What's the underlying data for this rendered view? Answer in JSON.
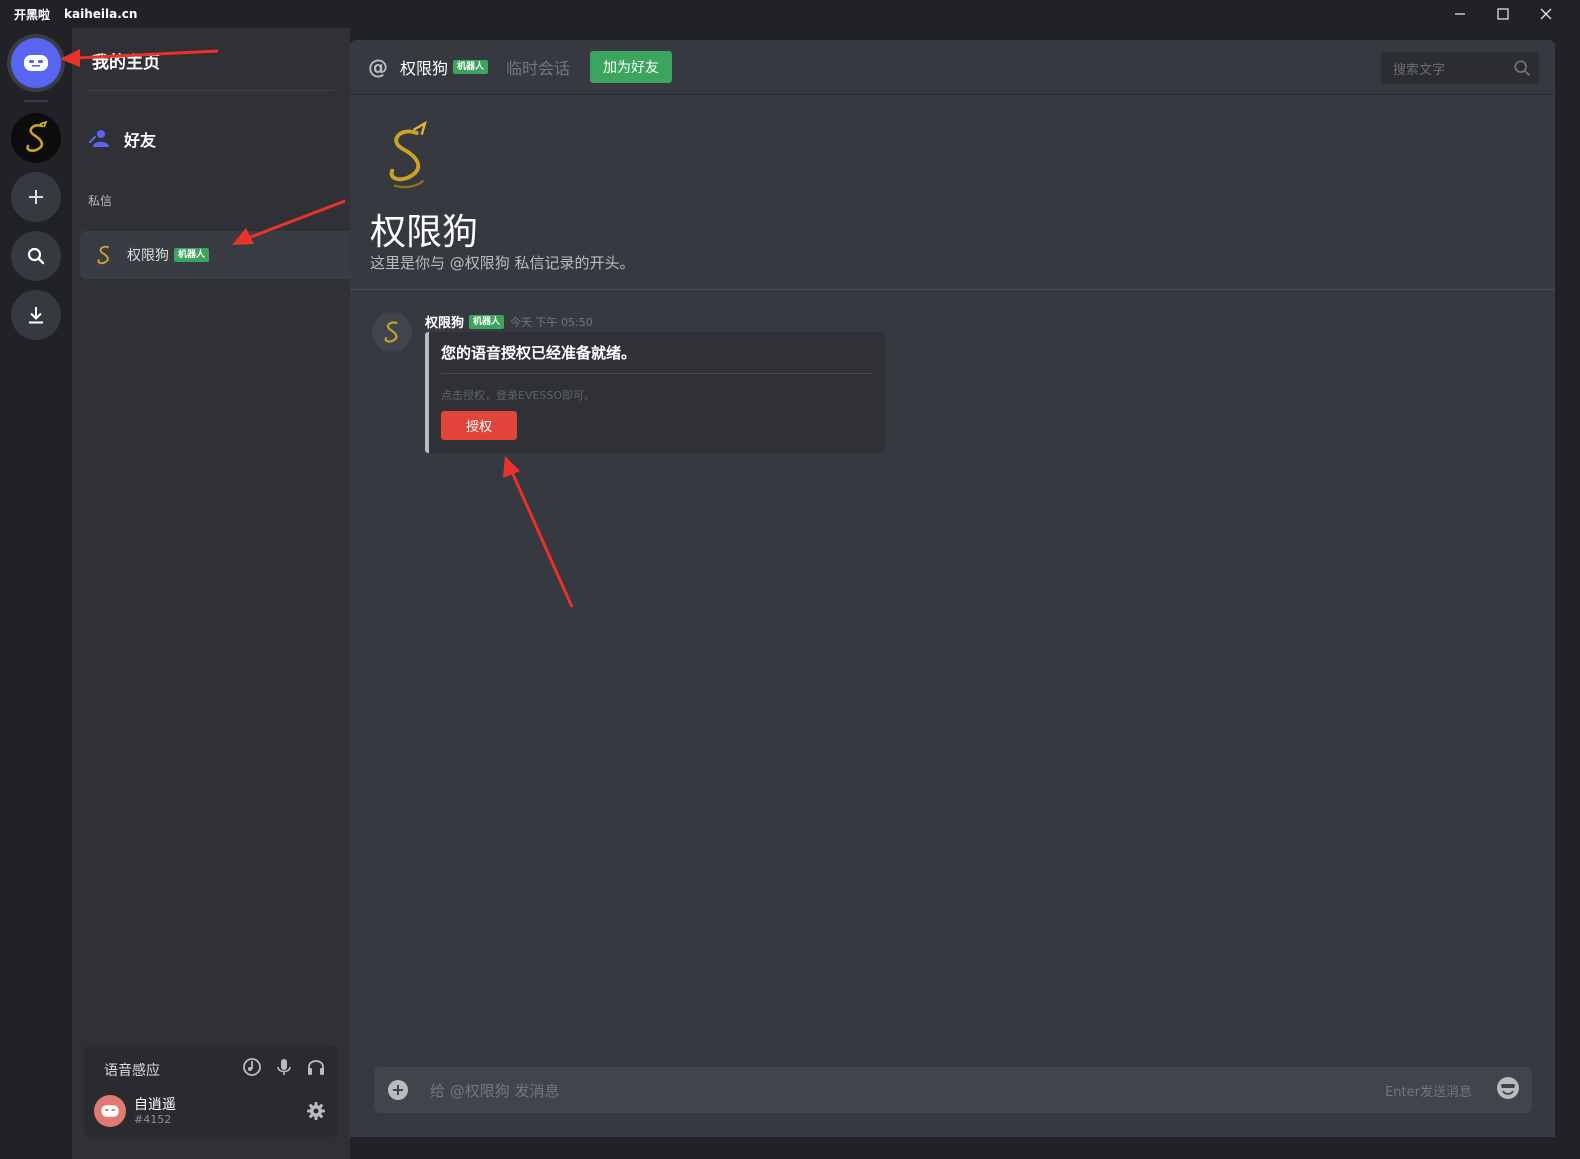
{
  "titlebar": {
    "brand": "开黑啦",
    "domain": "kaiheila.cn"
  },
  "sidebar": {
    "home_title": "我的主页",
    "friends_label": "好友",
    "dm_header": "私信",
    "dm_items": [
      {
        "name": "权限狗",
        "badge": "机器人"
      }
    ]
  },
  "user_panel": {
    "voice_label": "语音感应",
    "username": "自逍遥",
    "tag": "#4152"
  },
  "topbar": {
    "at_symbol": "@",
    "title": "权限狗",
    "badge": "机器人",
    "temp_label": "临时会话",
    "add_friend": "加为好友",
    "search_placeholder": "搜索文字"
  },
  "intro": {
    "name": "权限狗",
    "description": "这里是你与 @权限狗 私信记录的开头。"
  },
  "message": {
    "author": "权限狗",
    "badge": "机器人",
    "time": "今天 下午 05:50",
    "card_title": "您的语音授权已经准备就绪。",
    "card_desc": "点击授权，登录EVESSO即可。",
    "button": "授权"
  },
  "composer": {
    "placeholder": "给 @权限狗 发消息",
    "hint": "Enter发送消息"
  },
  "colors": {
    "accent": "#5865f2",
    "bot_badge": "#3ba55d",
    "add_friend": "#3ba55d",
    "authorize_button": "#e0443a",
    "annotation_arrow": "#e8322b"
  },
  "icons": [
    "app-logo-icon",
    "dragon-avatar-icon",
    "plus-icon",
    "search-icon",
    "download-icon",
    "friends-icon",
    "music-icon",
    "mic-icon",
    "headphones-icon",
    "gear-icon",
    "emoji-icon",
    "minimize-icon",
    "maximize-icon",
    "close-icon"
  ]
}
